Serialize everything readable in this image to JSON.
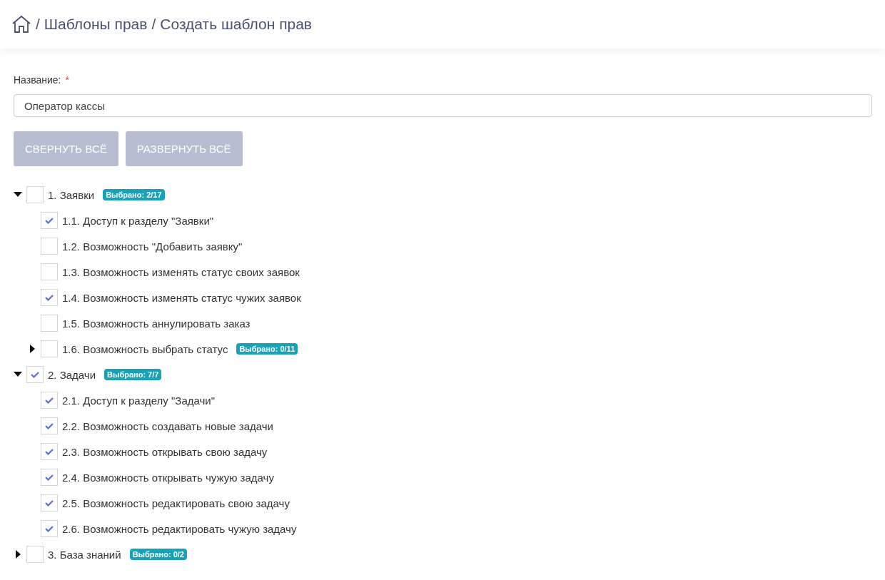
{
  "breadcrumb": {
    "separator": "/",
    "items": [
      "Шаблоны прав",
      "Создать шаблон прав"
    ]
  },
  "form": {
    "name_label": "Название:",
    "required_mark": "*",
    "name_value": "Оператор кассы"
  },
  "buttons": [
    "СВЕРНУТЬ ВСЁ",
    "РАЗВЕРНУТЬ ВСЁ"
  ],
  "tree": [
    {
      "label": "1. Заявки",
      "checked": false,
      "expanded": true,
      "badge": "Выбрано: 2/17",
      "children": [
        {
          "label": "1.1. Доступ к разделу \"Заявки\"",
          "checked": true
        },
        {
          "label": "1.2. Возможность \"Добавить заявку\"",
          "checked": false
        },
        {
          "label": "1.3. Возможность изменять статус своих заявок",
          "checked": false
        },
        {
          "label": "1.4. Возможность изменять статус чужих заявок",
          "checked": true
        },
        {
          "label": "1.5. Возможность аннулировать заказ",
          "checked": false
        },
        {
          "label": "1.6. Возможность выбрать статус",
          "checked": false,
          "expanded": false,
          "badge": "Выбрано: 0/11"
        }
      ]
    },
    {
      "label": "2. Задачи",
      "checked": true,
      "expanded": true,
      "badge": "Выбрано: 7/7",
      "children": [
        {
          "label": "2.1. Доступ к разделу \"Задачи\"",
          "checked": true
        },
        {
          "label": "2.2. Возможность создавать новые задачи",
          "checked": true
        },
        {
          "label": "2.3. Возможность открывать свою задачу",
          "checked": true
        },
        {
          "label": "2.4. Возможность открывать чужую задачу",
          "checked": true
        },
        {
          "label": "2.5. Возможность редактировать свою задачу",
          "checked": true
        },
        {
          "label": "2.6. Возможность редактировать чужую задачу",
          "checked": true
        }
      ]
    },
    {
      "label": "3. База знаний",
      "checked": false,
      "expanded": false,
      "badge": "Выбрано: 0/2"
    }
  ]
}
